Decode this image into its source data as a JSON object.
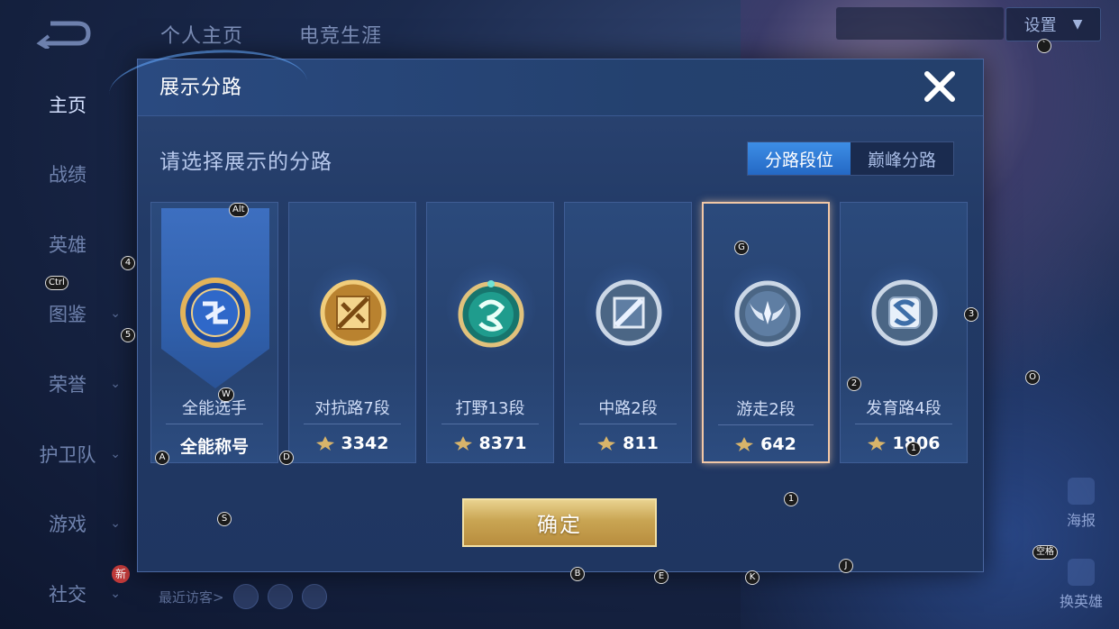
{
  "background": {
    "top_tabs": [
      "个人主页",
      "电竞生涯"
    ],
    "settings_label": "设置",
    "sidebar": [
      {
        "label": "主页",
        "active": true,
        "has_chevron": false
      },
      {
        "label": "战绩",
        "active": false,
        "has_chevron": false
      },
      {
        "label": "英雄",
        "active": false,
        "has_chevron": false
      },
      {
        "label": "图鉴",
        "active": false,
        "has_chevron": true
      },
      {
        "label": "荣誉",
        "active": false,
        "has_chevron": true
      },
      {
        "label": "护卫队",
        "active": false,
        "has_chevron": true
      },
      {
        "label": "游戏",
        "active": false,
        "has_chevron": true
      },
      {
        "label": "社交",
        "active": false,
        "has_chevron": true
      }
    ],
    "new_badge": "新",
    "recent_visitors_label": "最近访客>",
    "right_widgets": {
      "poster": "海报",
      "change_hero": "换英雄"
    }
  },
  "modal": {
    "title": "展示分路",
    "subtitle": "请选择展示的分路",
    "segments": [
      {
        "label": "分路段位",
        "active": true
      },
      {
        "label": "巅峰分路",
        "active": false
      }
    ],
    "cards": [
      {
        "name": "全能选手",
        "score": "全能称号",
        "show_star": false,
        "selected": false,
        "emblem": "allround-emblem",
        "color": "#d9a64a"
      },
      {
        "name": "对抗路7段",
        "score": "3342",
        "show_star": true,
        "selected": false,
        "emblem": "clash-lane-emblem",
        "color": "#d9a64a"
      },
      {
        "name": "打野13段",
        "score": "8371",
        "show_star": true,
        "selected": false,
        "emblem": "jungle-emblem",
        "color": "#2fb3a0"
      },
      {
        "name": "中路2段",
        "score": "811",
        "show_star": true,
        "selected": false,
        "emblem": "mid-lane-emblem",
        "color": "#a8b8cc"
      },
      {
        "name": "游走2段",
        "score": "642",
        "show_star": true,
        "selected": true,
        "emblem": "roam-emblem",
        "color": "#a8b8cc"
      },
      {
        "name": "发育路4段",
        "score": "1806",
        "show_star": true,
        "selected": false,
        "emblem": "farm-lane-emblem",
        "color": "#a8b8cc"
      }
    ],
    "confirm_label": "确定"
  },
  "hotkeys": [
    "Alt",
    "Ctrl",
    "4",
    "5",
    "W",
    "A",
    "D",
    "S",
    "G",
    "3",
    "2",
    "O",
    "1",
    "1",
    "B",
    "E",
    "K",
    "J",
    "空格",
    "`"
  ]
}
